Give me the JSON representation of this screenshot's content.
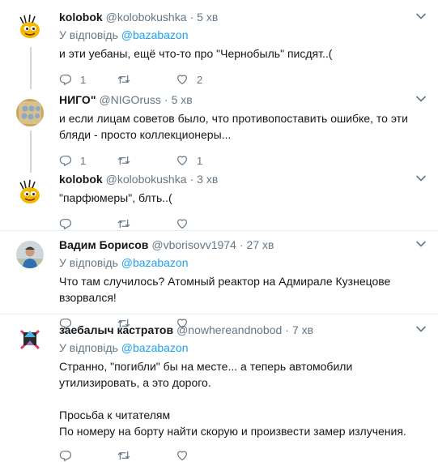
{
  "reply_prefix": "У відповідь",
  "tweets": [
    {
      "name": "kolobok",
      "handle": "@kolobokushka",
      "time": "5 хв",
      "reply_to": "@bazabazon",
      "text": "и эти уебаны, ещё что-то про \"Чернобыль\" писдят..(",
      "reply_count": "1",
      "retweet_count": "",
      "like_count": "2"
    },
    {
      "name": "НИГО\"",
      "handle": "@NIGOruss",
      "time": "5 хв",
      "text": "и если лицам советов было, что противопоставить ошибке, то эти бляди - просто коллекционеры...",
      "reply_count": "1",
      "retweet_count": "",
      "like_count": "1"
    },
    {
      "name": "kolobok",
      "handle": "@kolobokushka",
      "time": "3 хв",
      "text": "\"парфюмеры\", блть..(",
      "reply_count": "",
      "retweet_count": "",
      "like_count": ""
    },
    {
      "name": "Вадим Борисов",
      "handle": "@vborisovv1974",
      "time": "27 хв",
      "reply_to": "@bazabazon",
      "text": "Что там случилось? Атомный реактор на Адмирале Кузнецове взорвался!",
      "reply_count": "",
      "retweet_count": "",
      "like_count": ""
    },
    {
      "name": "заебалыч кастратов",
      "handle": "@nowhereandnobod",
      "time": "7 хв",
      "reply_to": "@bazabazon",
      "text": "Странно, \"погибли\" бы на месте... а теперь автомобили утилизировать, а это дорого.\n\nПросьба к читателям\nПо номеру на борту найти скорую и произвести замер излучения.",
      "reply_count": "",
      "retweet_count": "",
      "like_count": ""
    }
  ]
}
